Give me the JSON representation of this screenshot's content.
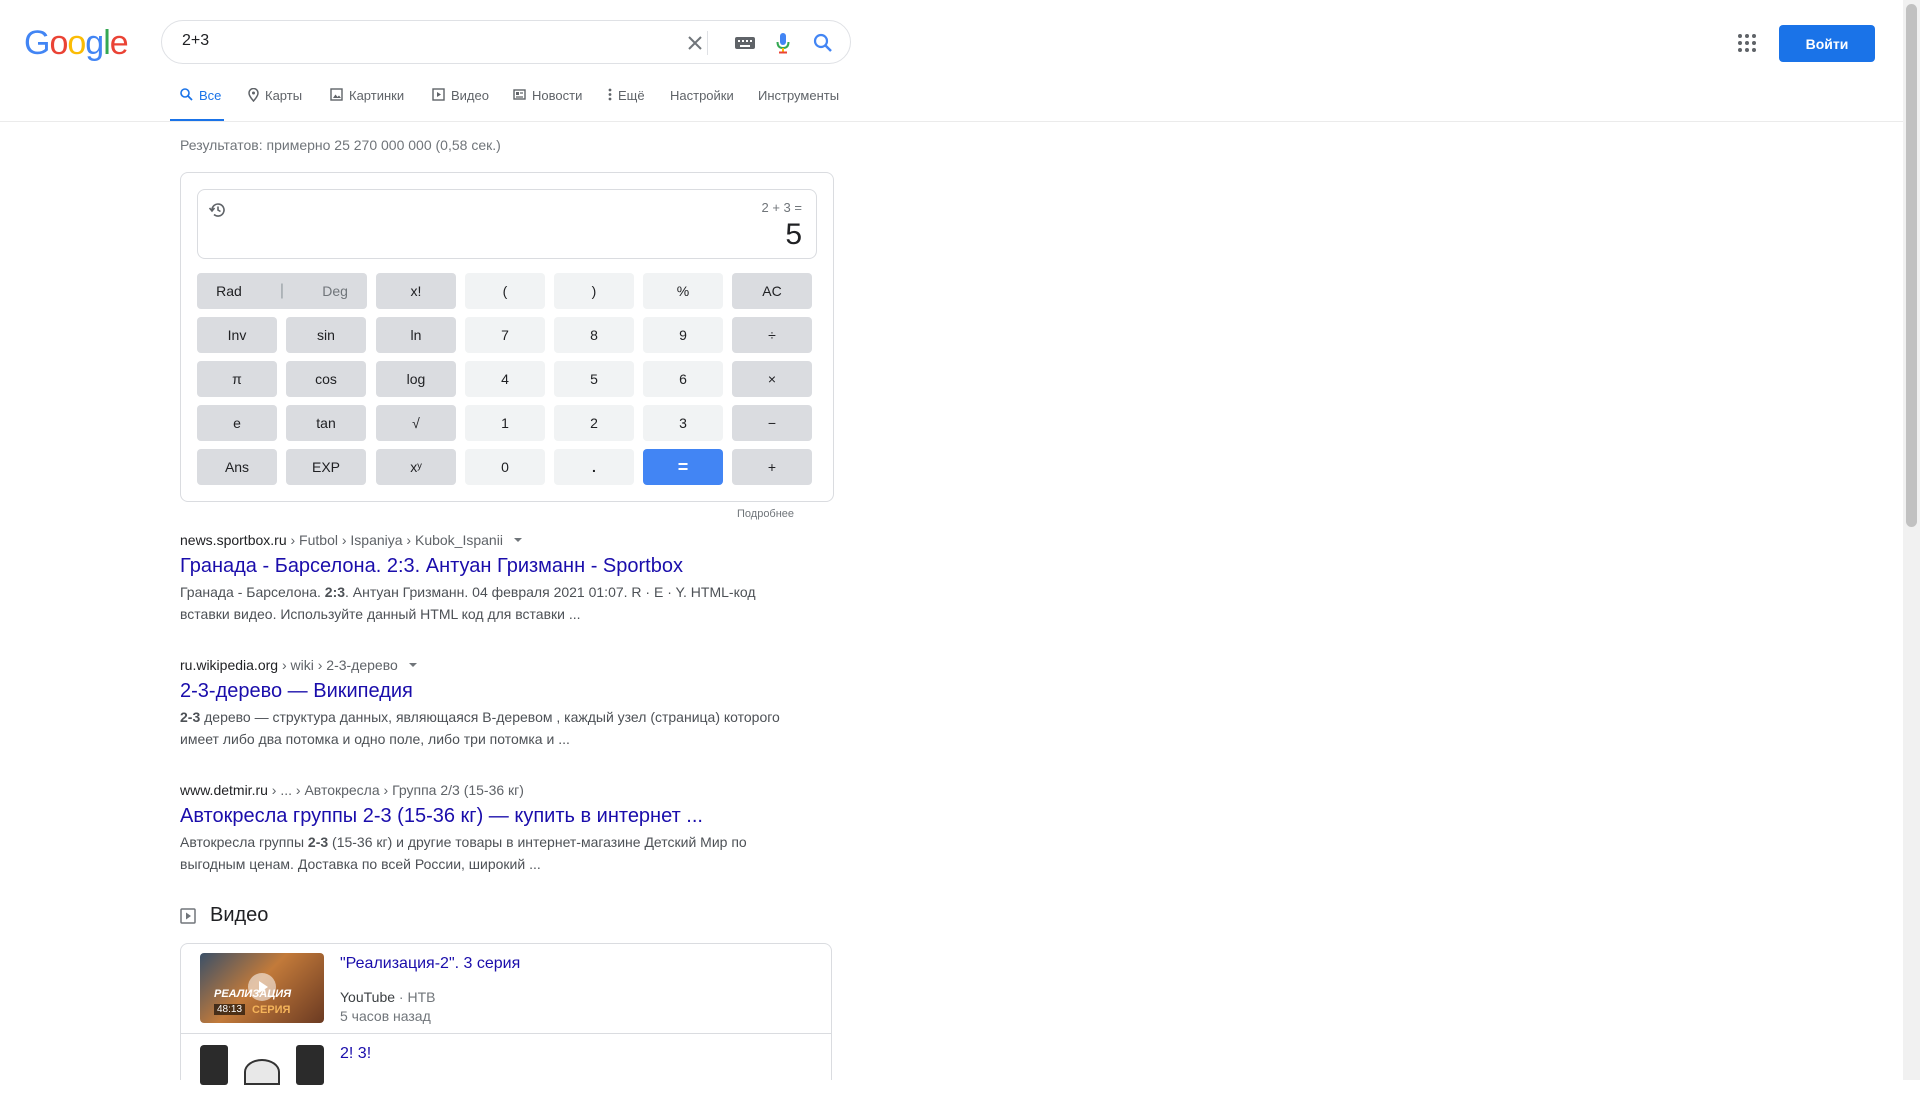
{
  "header": {
    "logo": [
      "G",
      "o",
      "o",
      "g",
      "l",
      "e"
    ],
    "logo_colors": [
      "#4285f4",
      "#ea4335",
      "#fbbc05",
      "#4285f4",
      "#34a853",
      "#ea4335"
    ],
    "query": "2+3",
    "signin_label": "Войти"
  },
  "tabs": [
    {
      "label": "Все",
      "icon": "search-icon",
      "active": true
    },
    {
      "label": "Карты",
      "icon": "map-pin-icon"
    },
    {
      "label": "Картинки",
      "icon": "image-icon"
    },
    {
      "label": "Видео",
      "icon": "video-icon"
    },
    {
      "label": "Новости",
      "icon": "news-icon"
    },
    {
      "label": "Ещё",
      "icon": "more-vert-icon"
    },
    {
      "label": "Настройки"
    },
    {
      "label": "Инструменты"
    }
  ],
  "stats": "Результатов: примерно 25 270 000 000 (0,58 сек.)",
  "calculator": {
    "expression": "2 + 3 =",
    "result": "5",
    "rad_label": "Rad",
    "deg_label": "Deg",
    "keys": [
      [
        "x!",
        "(",
        ")",
        "%",
        "AC"
      ],
      [
        "Inv",
        "sin",
        "ln",
        "7",
        "8",
        "9",
        "÷"
      ],
      [
        "π",
        "cos",
        "log",
        "4",
        "5",
        "6",
        "×"
      ],
      [
        "e",
        "tan",
        "√",
        "1",
        "2",
        "3",
        "−"
      ],
      [
        "Ans",
        "EXP",
        "xʸ",
        "0",
        ".",
        "=",
        "+"
      ]
    ],
    "more_label": "Подробнее"
  },
  "results": [
    {
      "domain": "news.sportbox.ru",
      "path": " › Futbol › Ispaniya › Kubok_Ispanii",
      "title": "Гранада - Барселона. 2:3. Антуан Гризманн - Sportbox",
      "snippet_before": "Гранада - Барселона. ",
      "snippet_bold": "2:3",
      "snippet_after": ". Антуан Гризманн. 04 февраля 2021 01:07. R · E · Y. HTML-код вставки видео. Используйте данный HTML код для вставки ..."
    },
    {
      "domain": "ru.wikipedia.org",
      "path": " › wiki › 2-3-дерево",
      "title": "2-3-дерево — Википедия",
      "snippet_before": "",
      "snippet_bold": "2-3",
      "snippet_after": " дерево — структура данных, являющаяся B-деревом , каждый узел (страница) которого имеет либо два потомка и одно поле, либо три потомка и ..."
    },
    {
      "domain": "www.detmir.ru",
      "path": " › ... › Автокресла › Группа 2/3 (15-36 кг)",
      "title": "Автокресла группы 2-3 (15-36 кг) — купить в интернет ...",
      "snippet_before": "Автокресла группы ",
      "snippet_bold": "2-3",
      "snippet_after": " (15-36 кг) и другие товары в интернет-магазине Детский Мир по выгодным ценам. Доставка по всей России, широкий ..."
    }
  ],
  "videos": {
    "heading": "Видео",
    "items": [
      {
        "title": "\"Реализация-2\". 3 серия",
        "source": "YouTube",
        "channel": " · НТВ",
        "age": "5 часов назад",
        "duration": "48:13",
        "thumb_text": "РЕАЛИЗАЦИЯ",
        "thumb_sub": "СЕРИЯ"
      },
      {
        "title": "2! 3!"
      }
    ]
  }
}
